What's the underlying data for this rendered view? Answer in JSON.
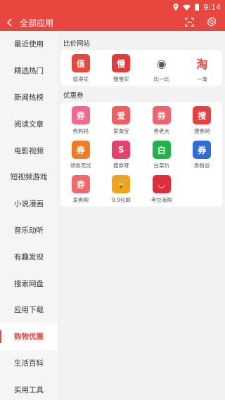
{
  "status": {
    "time": "9:14"
  },
  "header": {
    "title": "全部应用",
    "back_icon": "back-arrow-icon",
    "scan_icon": "scan-icon",
    "settings_icon": "gear-icon"
  },
  "sidebar": {
    "items": [
      {
        "label": "最近使用"
      },
      {
        "label": "精选热门"
      },
      {
        "label": "新闻热榜"
      },
      {
        "label": "阅读文章"
      },
      {
        "label": "电影视频"
      },
      {
        "label": "短视频游戏"
      },
      {
        "label": "小说漫画"
      },
      {
        "label": "音乐动听"
      },
      {
        "label": "有趣发现"
      },
      {
        "label": "搜索网盘"
      },
      {
        "label": "应用下载"
      },
      {
        "label": "购物优惠"
      },
      {
        "label": "生活百科"
      },
      {
        "label": "实用工具"
      }
    ],
    "active_index": 11
  },
  "sections": [
    {
      "title": "比价网站",
      "apps": [
        {
          "label": "值得买",
          "glyph": "值",
          "color": "#e8473f"
        },
        {
          "label": "慢慢买",
          "glyph": "慢",
          "color": "#e23b3b"
        },
        {
          "label": "比一比",
          "glyph": "◉",
          "color": "#ffffff"
        },
        {
          "label": "一淘",
          "glyph": "淘",
          "color": "#ffffff"
        }
      ]
    },
    {
      "title": "优惠券",
      "apps": [
        {
          "label": "券妈妈",
          "glyph": "券",
          "color": "#f06a8a"
        },
        {
          "label": "爱淘宝",
          "glyph": "爱",
          "color": "#f25e5e"
        },
        {
          "label": "券老大",
          "glyph": "券",
          "color": "#f2646a"
        },
        {
          "label": "搜券网",
          "glyph": "搜",
          "color": "#e84040"
        },
        {
          "label": "领券无忧",
          "glyph": "券",
          "color": "#f37b21"
        },
        {
          "label": "搜券呀",
          "glyph": "S",
          "color": "#e8406a"
        },
        {
          "label": "白菜价",
          "glyph": "白",
          "color": "#22b14c"
        },
        {
          "label": "券粉丝",
          "glyph": "券",
          "color": "#2d6fd6"
        },
        {
          "label": "发券网",
          "glyph": "券",
          "color": "#f06a6a"
        },
        {
          "label": "9.9包邮",
          "glyph": "🔒",
          "color": "#f4a21b"
        },
        {
          "label": "考拉海购",
          "glyph": "◡",
          "color": "#e02d3c"
        }
      ]
    }
  ]
}
